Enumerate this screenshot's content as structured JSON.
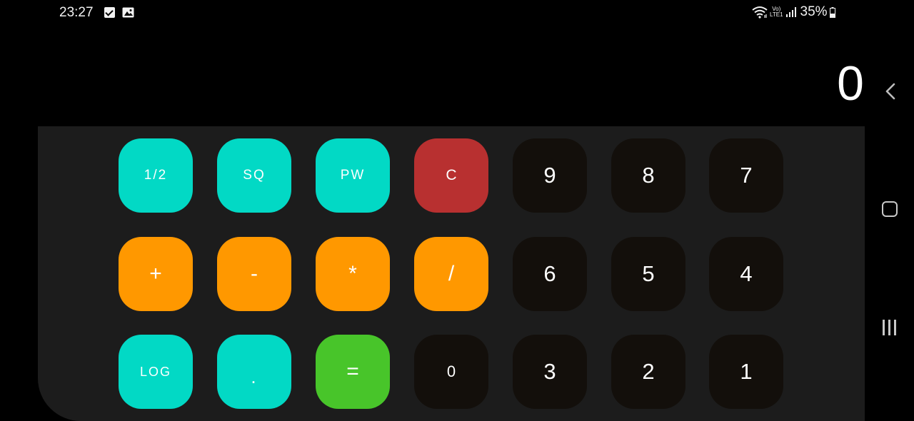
{
  "status_bar": {
    "time": "23:27",
    "icons_left": [
      "check-box-icon",
      "image-icon"
    ],
    "icons_right": [
      "wifi-icon",
      "volte-icon",
      "signal-icon",
      "battery-icon"
    ],
    "volte_line1": "Vo)",
    "volte_line2": "LTE1",
    "battery": "35%"
  },
  "display": {
    "value": "0",
    "backspace_icon": "chevron-left-icon"
  },
  "keypad": {
    "rows": [
      [
        "1/2",
        "SQ",
        "PW",
        "C",
        "9",
        "8",
        "7"
      ],
      [
        "+",
        "-",
        "*",
        "/",
        "6",
        "5",
        "4"
      ],
      [
        "LOG",
        ".",
        "=",
        "0",
        "3",
        "2",
        "1"
      ]
    ]
  },
  "nav_bar": {
    "icons": [
      "home-icon",
      "recents-icon"
    ]
  },
  "colors": {
    "background": "#000000",
    "keypad_panel": "#1c1c1c",
    "function_key": "#02d9c5",
    "operator_key": "#ff9800",
    "clear_key": "#b83030",
    "equals_key": "#48c52a",
    "number_key": "#130f0b",
    "text": "#ffffff"
  }
}
